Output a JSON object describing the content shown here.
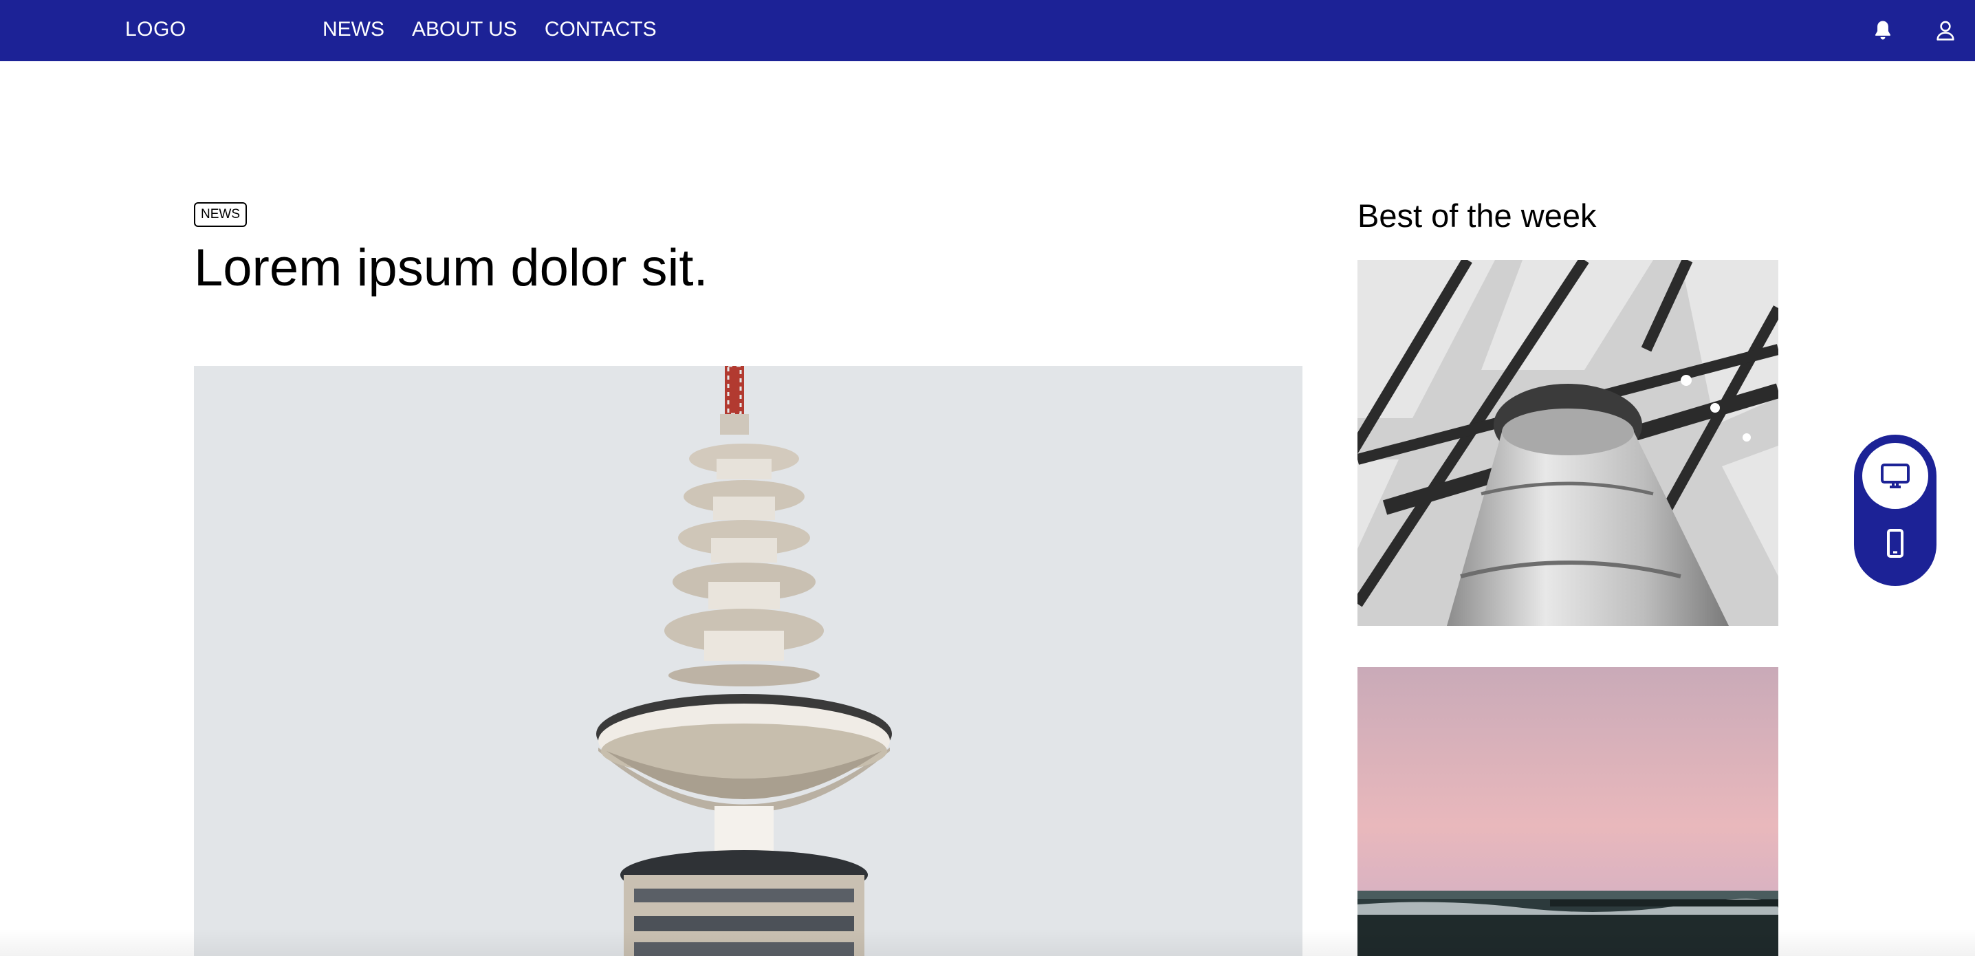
{
  "header": {
    "logo": "LOGO",
    "nav": [
      {
        "label": "NEWS"
      },
      {
        "label": "ABOUT US"
      },
      {
        "label": "CONTACTS"
      }
    ],
    "icons": [
      "bell-icon",
      "user-icon"
    ]
  },
  "article": {
    "tag": "NEWS",
    "title": "Lorem ipsum dolor sit."
  },
  "sidebar": {
    "title": "Best of the week"
  },
  "device_toggle": {
    "options": [
      "desktop-icon",
      "phone-icon"
    ],
    "selected": "desktop"
  },
  "colors": {
    "brand": "#1c2296",
    "background": "#ffffff",
    "text": "#000000"
  }
}
